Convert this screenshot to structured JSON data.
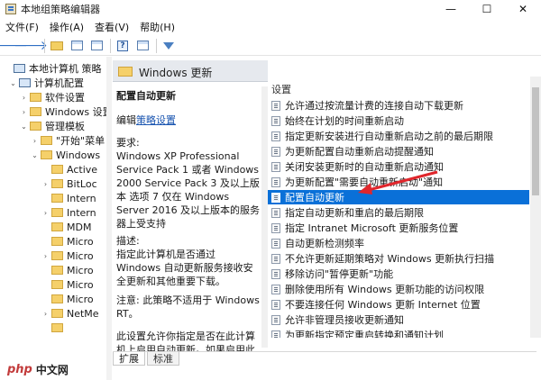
{
  "window": {
    "title": "本地组策略编辑器",
    "minimize": "—",
    "maximize": "☐",
    "close": "✕"
  },
  "menu": [
    "文件(F)",
    "操作(A)",
    "查看(V)",
    "帮助(H)"
  ],
  "toolbar": {
    "back_icon": "arrow-left-icon",
    "forward_icon": "arrow-right-icon"
  },
  "tree": [
    {
      "label": "本地计算机 策略",
      "level": 0,
      "expander": "",
      "icon": "computer"
    },
    {
      "label": "计算机配置",
      "level": 1,
      "expander": "⌄",
      "icon": "computer"
    },
    {
      "label": "软件设置",
      "level": 2,
      "expander": "›",
      "icon": "folder"
    },
    {
      "label": "Windows 设置",
      "level": 2,
      "expander": "›",
      "icon": "folder"
    },
    {
      "label": "管理模板",
      "level": 2,
      "expander": "⌄",
      "icon": "folder"
    },
    {
      "label": "\"开始\"菜单",
      "level": 3,
      "expander": "›",
      "icon": "folder"
    },
    {
      "label": "Windows",
      "level": 3,
      "expander": "⌄",
      "icon": "folder"
    },
    {
      "label": "Active",
      "level": 4,
      "expander": "",
      "icon": "folder"
    },
    {
      "label": "BitLoc",
      "level": 4,
      "expander": "›",
      "icon": "folder"
    },
    {
      "label": "Intern",
      "level": 4,
      "expander": "",
      "icon": "folder"
    },
    {
      "label": "Intern",
      "level": 4,
      "expander": "›",
      "icon": "folder"
    },
    {
      "label": "MDM",
      "level": 4,
      "expander": "",
      "icon": "folder"
    },
    {
      "label": "Micro",
      "level": 4,
      "expander": "",
      "icon": "folder"
    },
    {
      "label": "Micro",
      "level": 4,
      "expander": "›",
      "icon": "folder"
    },
    {
      "label": "Micro",
      "level": 4,
      "expander": "",
      "icon": "folder"
    },
    {
      "label": "Micro",
      "level": 4,
      "expander": "",
      "icon": "folder"
    },
    {
      "label": "Micro",
      "level": 4,
      "expander": "",
      "icon": "folder"
    },
    {
      "label": "NetMe",
      "level": 4,
      "expander": "›",
      "icon": "folder"
    },
    {
      "label": "",
      "level": 4,
      "expander": "",
      "icon": "folder"
    }
  ],
  "header": {
    "title": "Windows 更新"
  },
  "description": {
    "title": "配置自动更新",
    "edit_prefix": "编辑",
    "edit_link": "策略设置",
    "requirements": "要求:\nWindows XP Professional Service Pack 1 或者 Windows 2000 Service Pack 3 及以上版本 选项 7 仅在 Windows Server 2016 及以上版本的服务器上受支持",
    "text": "描述:\n指定此计算机是否通过 Windows 自动更新服务接收安全更新和其他重要下载。",
    "note": "注意: 此策略不适用于 Windows RT。",
    "more": "此设置允许你指定是否在此计算机上启用自动更新。如果启用此服"
  },
  "list": {
    "column": "设置",
    "items": [
      "允许通过按流量计费的连接自动下载更新",
      "始终在计划的时间重新启动",
      "指定更新安装进行自动重新启动之前的最后期限",
      "为更新配置自动重新启动提醒通知",
      "关闭安装更新时的自动重新启动通知",
      "为更新配置\"需要自动重新启动\"通知",
      "配置自动更新",
      "指定自动更新和重启的最后期限",
      "指定 Intranet Microsoft 更新服务位置",
      "自动更新检测频率",
      "不允许更新延期策略对 Windows 更新执行扫描",
      "移除访问\"暂停更新\"功能",
      "删除使用所有 Windows 更新功能的访问权限",
      "不要连接任何 Windows 更新 Internet 位置",
      "允许非管理员接收更新通知",
      "为更新指定预定重启转换和通知计划"
    ],
    "selected_index": 6,
    "selection_color": "#0a70d8"
  },
  "tabs": [
    "扩展",
    "标准"
  ],
  "watermark": {
    "logo": "php",
    "text": "中文网"
  },
  "accent_colors": {
    "annotation_arrow": "#e0262c"
  }
}
